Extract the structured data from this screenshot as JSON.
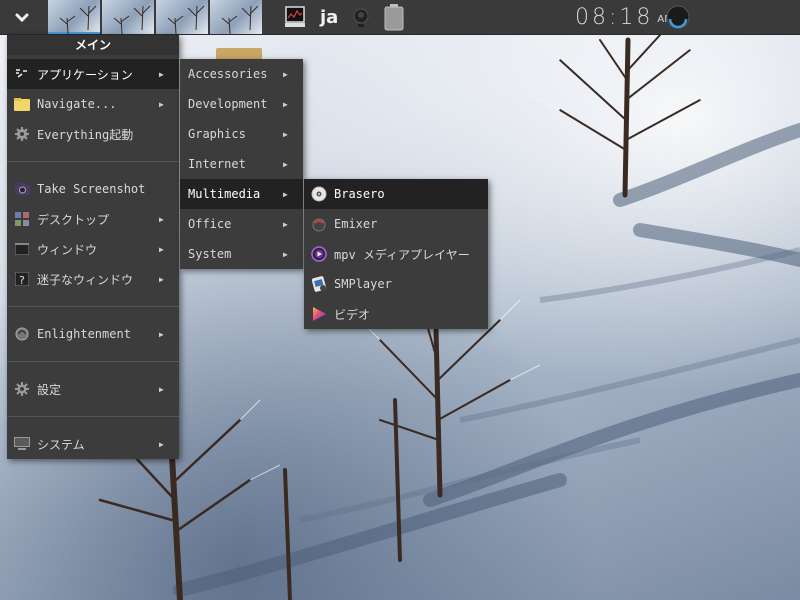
{
  "shelf": {
    "start_icon": "chevron-down-icon",
    "pager_desks": 4,
    "tray": {
      "monitor_icon": "system-monitor-icon",
      "language": "ja",
      "mixer_icon": "volume-knob-icon",
      "battery_icon": "battery-icon"
    },
    "clock": {
      "time": "08:18",
      "ampm": "AM"
    }
  },
  "main_menu": {
    "title": "メイン",
    "items": [
      {
        "label": "アプリケーション",
        "icon": "applications-icon",
        "submenu": true,
        "active": true
      },
      {
        "label": "Navigate...",
        "icon": "folder-icon",
        "submenu": true
      },
      {
        "label": "Everything起動",
        "icon": "gear-icon",
        "submenu": false
      },
      {
        "label": "Take Screenshot",
        "icon": "camera-icon",
        "submenu": false
      },
      {
        "label": "デスクトップ",
        "icon": "desktop-icon",
        "submenu": true
      },
      {
        "label": "ウィンドウ",
        "icon": "window-icon",
        "submenu": true
      },
      {
        "label": "迷子なウィンドウ",
        "icon": "lost-window-icon",
        "submenu": true
      },
      {
        "label": "Enlightenment",
        "icon": "enlightenment-icon",
        "submenu": true
      },
      {
        "label": "設定",
        "icon": "gear-icon",
        "submenu": true
      },
      {
        "label": "システム",
        "icon": "computer-icon",
        "submenu": true
      }
    ]
  },
  "apps_menu": {
    "items": [
      {
        "label": "Accessories"
      },
      {
        "label": "Development"
      },
      {
        "label": "Graphics"
      },
      {
        "label": "Internet"
      },
      {
        "label": "Multimedia",
        "active": true
      },
      {
        "label": "Office"
      },
      {
        "label": "System"
      }
    ]
  },
  "multimedia_menu": {
    "items": [
      {
        "label": "Brasero",
        "icon": "brasero-disc-icon",
        "active": true
      },
      {
        "label": "Emixer",
        "icon": "emixer-icon"
      },
      {
        "label": "mpv メディアプレイヤー",
        "icon": "mpv-icon"
      },
      {
        "label": "SMPlayer",
        "icon": "smplayer-icon"
      },
      {
        "label": "ビデオ",
        "icon": "video-play-icon"
      }
    ]
  },
  "colors": {
    "shelf_bg": "#3a3a3a",
    "menu_bg": "#3c3c3c",
    "menu_active_bg": "#222222",
    "accent": "#4a9bd9"
  }
}
